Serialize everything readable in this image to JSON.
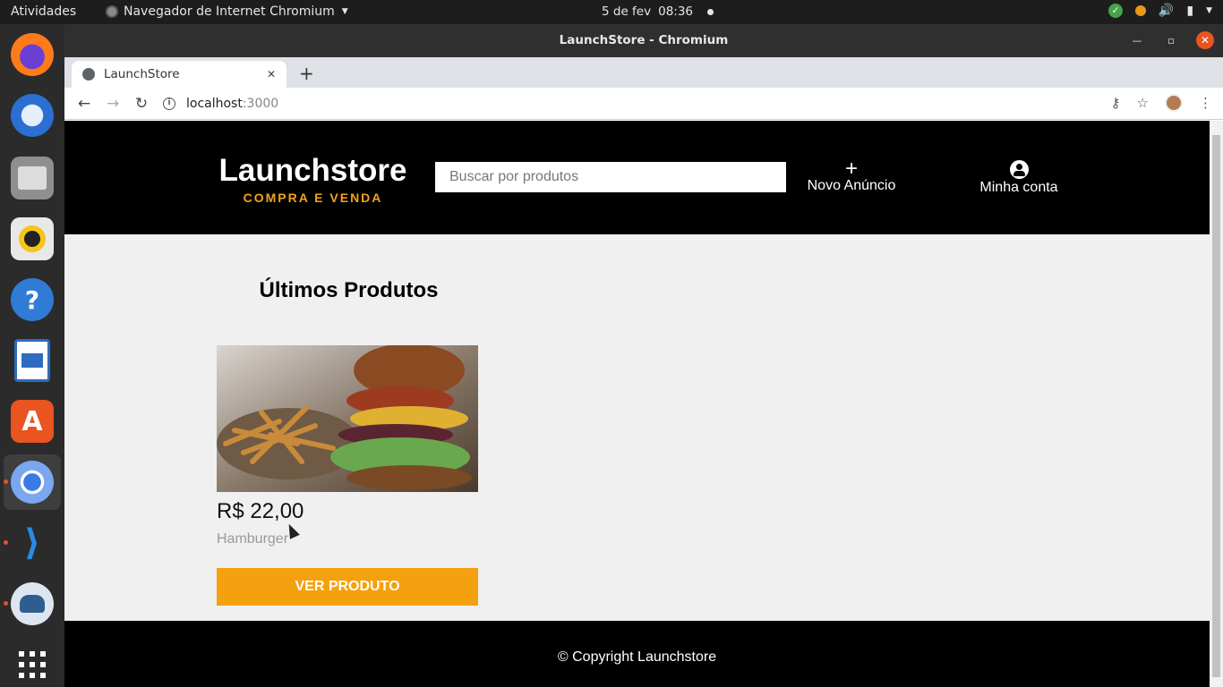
{
  "desktop": {
    "activities": "Atividades",
    "app_name": "Navegador de Internet Chromium",
    "date": "5 de fev",
    "time": "08:36",
    "dock_items": [
      "firefox-icon",
      "thunderbird-icon",
      "files-icon",
      "rhythmbox-icon",
      "help-icon",
      "writer-icon",
      "software-icon",
      "chromium-icon",
      "vscode-icon",
      "database-icon",
      "app-grid-icon"
    ]
  },
  "window": {
    "title": "LaunchStore - Chromium"
  },
  "browser": {
    "tab_title": "LaunchStore",
    "url_host": "localhost",
    "url_port": ":3000"
  },
  "site": {
    "logo_title": "Launchstore",
    "logo_subtitle": "COMPRA E VENDA",
    "search_placeholder": "Buscar por produtos",
    "new_ad_label": "Novo Anúncio",
    "account_label": "Minha conta",
    "section_title": "Últimos Produtos",
    "products": [
      {
        "price": "R$ 22,00",
        "name": "Hamburger",
        "button": "VER PRODUTO",
        "image": "hamburger-with-fries-photo"
      }
    ],
    "footer": "© Copyright Launchstore"
  },
  "colors": {
    "accent": "#f5a00e",
    "header_bg": "#000000",
    "page_bg": "#f0f0f0"
  }
}
